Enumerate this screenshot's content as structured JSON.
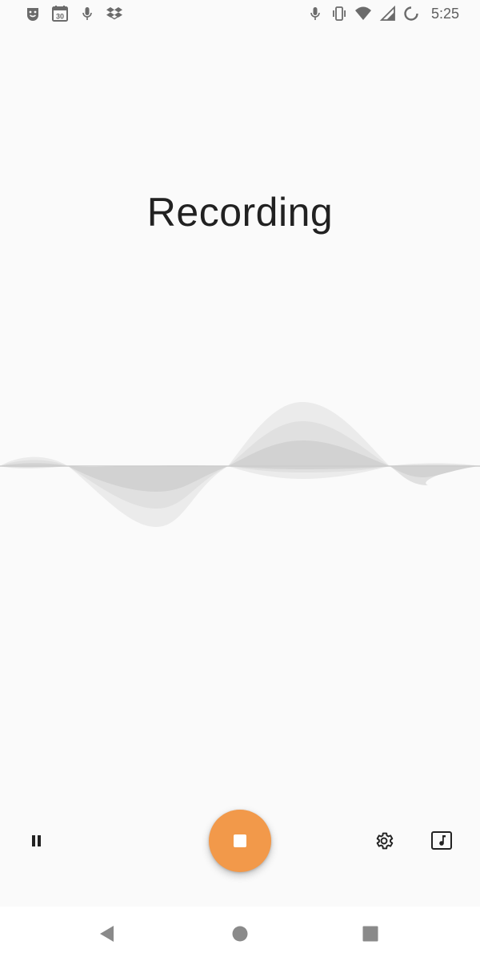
{
  "status_bar": {
    "time": "5:25",
    "left_icons": [
      "face-icon",
      "calendar-icon",
      "mic-icon",
      "dropbox-icon"
    ],
    "calendar_day": "30",
    "right_icons": [
      "mic-icon",
      "vibrate-icon",
      "wifi-icon",
      "signal-icon",
      "battery-saver-icon"
    ]
  },
  "main": {
    "title": "Recording"
  },
  "controls": {
    "pause_icon": "pause-icon",
    "stop_icon": "stop-icon",
    "settings_icon": "gear-icon",
    "music_icon": "music-note-icon",
    "accent_color": "#f2994a"
  },
  "navigation": {
    "icons": [
      "back-icon",
      "home-icon",
      "recents-icon"
    ]
  }
}
